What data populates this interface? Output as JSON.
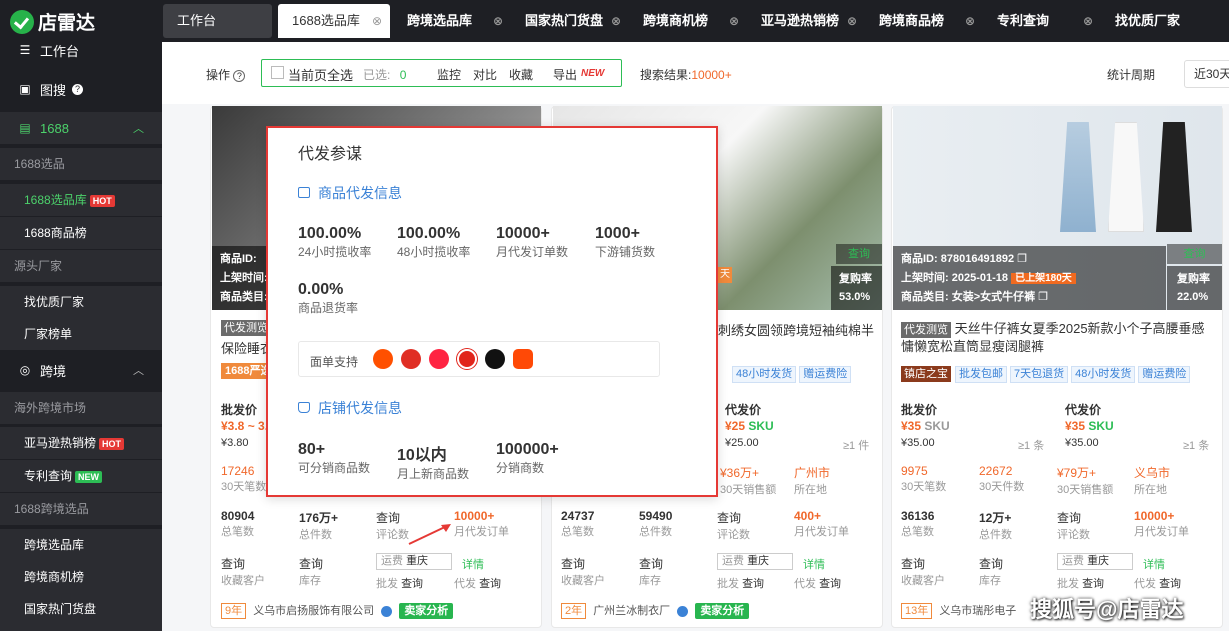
{
  "app": {
    "name": "店雷达"
  },
  "sidebar": {
    "top_items": [
      {
        "label": "工作台"
      },
      {
        "label": "图搜"
      }
    ],
    "group_1688": {
      "label": "1688"
    },
    "sec_1688": "1688选品",
    "sub_1688": [
      {
        "label": "1688选品库",
        "badge": "HOT"
      },
      {
        "label": "1688商品榜"
      }
    ],
    "sec_source": "源头厂家",
    "sub_source": [
      {
        "label": "找优质厂家"
      },
      {
        "label": "厂家榜单"
      }
    ],
    "group_cross": {
      "label": "跨境"
    },
    "sec_overseas": "海外跨境市场",
    "sub_overseas": [
      {
        "label": "亚马逊热销榜",
        "badge": "HOT"
      },
      {
        "label": "专利查询",
        "badge": "NEW"
      }
    ],
    "sec_cross1688": "1688跨境选品",
    "sub_cross1688": [
      {
        "label": "跨境选品库"
      },
      {
        "label": "跨境商机榜"
      },
      {
        "label": "国家热门货盘"
      }
    ]
  },
  "tabs": [
    {
      "label": "工作台"
    },
    {
      "label": "1688选品库"
    },
    {
      "label": "跨境选品库"
    },
    {
      "label": "国家热门货盘"
    },
    {
      "label": "跨境商机榜"
    },
    {
      "label": "亚马逊热销榜"
    },
    {
      "label": "跨境商品榜"
    },
    {
      "label": "专利查询"
    },
    {
      "label": "找优质厂家"
    }
  ],
  "toolbar": {
    "op_label": "操作",
    "select_all": "当前页全选",
    "selected_label": "已选:",
    "selected_count": "0",
    "monitor": "监控",
    "compare": "对比",
    "collect": "收藏",
    "export": "导出",
    "export_badge": "NEW",
    "results_label": "搜索结果:",
    "results_value": "10000+",
    "period_label": "统计周期",
    "period_value": "近30天"
  },
  "popup": {
    "title": "代发参谋",
    "sec1": "商品代发信息",
    "m1": [
      {
        "v": "100.00%",
        "l": "24小时揽收率"
      },
      {
        "v": "100.00%",
        "l": "48小时揽收率"
      },
      {
        "v": "10000+",
        "l": "月代发订单数"
      },
      {
        "v": "1000+",
        "l": "下游铺货数"
      }
    ],
    "m2": {
      "v": "0.00%",
      "l": "商品退货率"
    },
    "support_label": "面单支持",
    "sec2": "店铺代发信息",
    "m3": [
      {
        "v": "80+",
        "l": "可分销商品数"
      },
      {
        "v": "10以内",
        "l": "月上新商品数"
      },
      {
        "v": "100000+",
        "l": "分销商数"
      }
    ]
  },
  "card1": {
    "overlay": [
      "商品ID:",
      "上架时间:",
      "商品类目:"
    ],
    "tag": "代发测览",
    "title": "保险睡衣",
    "badge": "1688严选",
    "price_label": "批发价",
    "price": "¥3.8 ~ 3.",
    "ref": "¥3.80",
    "row1": [
      {
        "v": "17246",
        "l": "30天笔数"
      }
    ],
    "row2": [
      {
        "v": "80904",
        "l": "总笔数"
      },
      {
        "v": "176万+",
        "l": "总件数"
      },
      {
        "v": "查询",
        "l": "评论数"
      },
      {
        "v": "10000+",
        "l": "月代发订单"
      }
    ],
    "row3": [
      {
        "v": "查询",
        "l": "收藏客户"
      },
      {
        "v": "查询",
        "l": "库存"
      }
    ],
    "ship_label": "运费",
    "ship_city": "重庆",
    "ship_detail": "详情",
    "wholesale": "批发",
    "dropship": "代发",
    "query": "查询",
    "years": "9年",
    "company": "义乌市启扬服饰有限公司",
    "analysis": "卖家分析"
  },
  "card2": {
    "check": "查询",
    "repurchase_label": "复购率",
    "repurchase": "53.0%",
    "days": "天",
    "title": "刺绣女圆领跨境短袖纯棉半",
    "tags": [
      "48小时发货",
      "赠运费险"
    ],
    "price_label": "代发价",
    "price": "¥25",
    "sku": "SKU",
    "ref": "¥25.00",
    "min": "≥1 件",
    "row1": [
      {
        "v": "¥36万+",
        "l": "30天销售额"
      },
      {
        "v": "广州市",
        "l": "所在地"
      }
    ],
    "row2": [
      {
        "v": "24737",
        "l": "总笔数"
      },
      {
        "v": "59490",
        "l": "总件数"
      },
      {
        "v": "查询",
        "l": "评论数"
      },
      {
        "v": "400+",
        "l": "月代发订单"
      }
    ],
    "row3": [
      {
        "v": "查询",
        "l": "收藏客户"
      },
      {
        "v": "查询",
        "l": "库存"
      }
    ],
    "ship_label": "运费",
    "ship_city": "重庆",
    "ship_detail": "详情",
    "wholesale": "批发",
    "dropship": "代发",
    "query": "查询",
    "years": "2年",
    "company": "广州兰冰制衣厂",
    "analysis": "卖家分析"
  },
  "card3": {
    "id_label": "商品ID:",
    "id": "878016491892",
    "time_label": "上架时间:",
    "time": "2025-01-18",
    "time_badge": "已上架180天",
    "cat_label": "商品类目:",
    "cat": "女装>女式牛仔裤",
    "check": "查询",
    "repurchase_label": "复购率",
    "repurchase": "22.0%",
    "tag": "代发测览",
    "title": "天丝牛仔裤女夏季2025新款小个子高腰垂感慵懒宽松直筒显瘦阔腿裤",
    "shop_tag": "镇店之宝",
    "tags": [
      "批发包邮",
      "7天包退货",
      "48小时发货",
      "赠运费险"
    ],
    "w_label": "批发价",
    "w_price": "¥35",
    "w_ref": "¥35.00",
    "w_min": "≥1 条",
    "d_label": "代发价",
    "d_price": "¥35",
    "d_ref": "¥35.00",
    "d_min": "≥1 条",
    "sku": "SKU",
    "row1": [
      {
        "v": "9975",
        "l": "30天笔数"
      },
      {
        "v": "22672",
        "l": "30天件数"
      },
      {
        "v": "¥79万+",
        "l": "30天销售额"
      },
      {
        "v": "义乌市",
        "l": "所在地"
      }
    ],
    "row2": [
      {
        "v": "36136",
        "l": "总笔数"
      },
      {
        "v": "12万+",
        "l": "总件数"
      },
      {
        "v": "查询",
        "l": "评论数"
      },
      {
        "v": "10000+",
        "l": "月代发订单"
      }
    ],
    "row3": [
      {
        "v": "查询",
        "l": "收藏客户"
      },
      {
        "v": "查询",
        "l": "库存"
      }
    ],
    "ship_label": "运费",
    "ship_city": "重庆",
    "ship_detail": "详情",
    "wholesale": "批发",
    "dropship": "代发",
    "query": "查询",
    "years": "13年",
    "company": "义乌市瑞彤电子"
  },
  "watermark": "搜狐号@店雷达"
}
